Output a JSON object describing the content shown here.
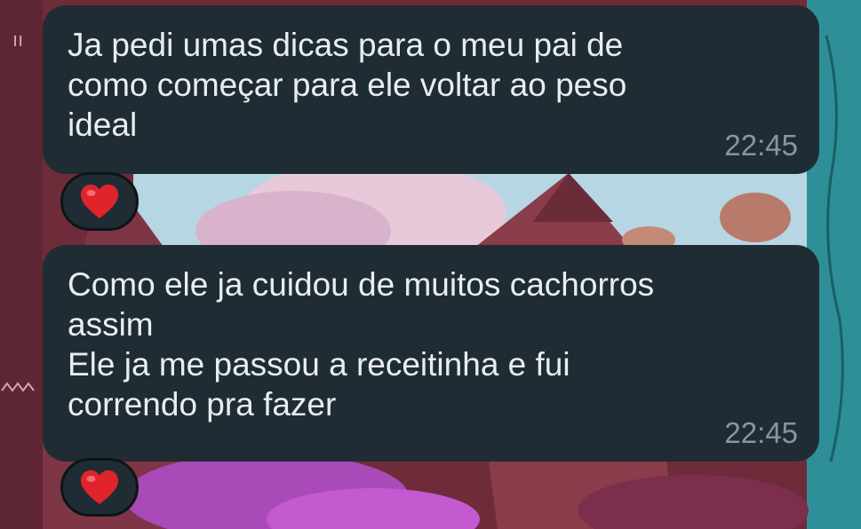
{
  "messages": [
    {
      "text": "Ja pedi umas dicas para o meu pai de\ncomo começar para ele voltar ao peso\nideal",
      "time": "22:45",
      "reaction_icon": "red-heart-icon"
    },
    {
      "text": "Como ele ja cuidou de muitos cachorros\nassim\nEle ja me passou a receitinha e fui\ncorrendo pra fazer",
      "time": "22:45",
      "reaction_icon": "red-heart-icon"
    }
  ],
  "colors": {
    "bubble_bg": "#1f2c33",
    "text": "#e9edef",
    "timestamp": "#8696a0",
    "heart": "#e0242c"
  }
}
